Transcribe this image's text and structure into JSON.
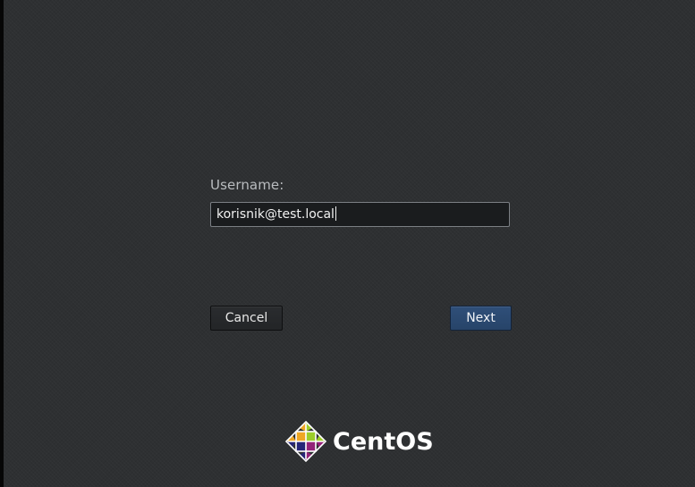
{
  "login": {
    "username_label": "Username:",
    "username_value": "korisnik@test.local"
  },
  "buttons": {
    "cancel_label": "Cancel",
    "next_label": "Next"
  },
  "branding": {
    "logo_text": "CentOS",
    "logo_icon": "centos-logo-icon"
  },
  "colors": {
    "background": "#2e3032",
    "next_button": "#2d4b73",
    "label_text": "#b9bcbf",
    "input_border": "#7b7f84"
  }
}
